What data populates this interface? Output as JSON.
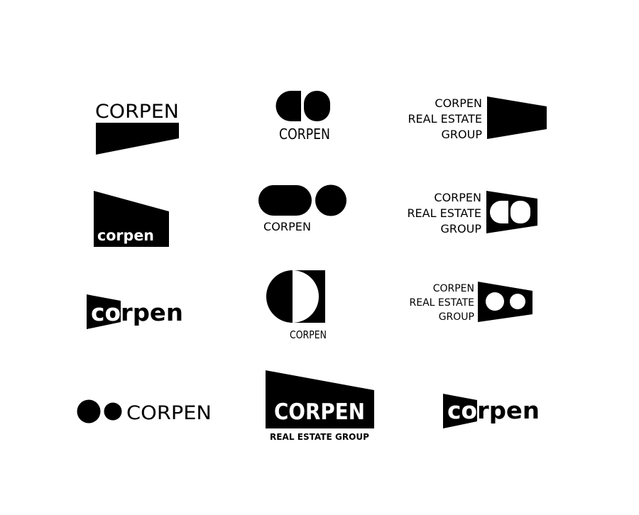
{
  "colors": {
    "ink": "#000000",
    "paper": "#ffffff"
  },
  "logos": {
    "l1": {
      "text": "CORPEN"
    },
    "l2": {
      "text": "CORPEN"
    },
    "l3": {
      "line1": "CORPEN",
      "line2": "REAL ESTATE",
      "line3": "GROUP"
    },
    "l4": {
      "text": "corpen"
    },
    "l5": {
      "text": "CORPEN"
    },
    "l6": {
      "line1": "CORPEN",
      "line2": "REAL ESTATE",
      "line3": "GROUP"
    },
    "l7": {
      "text": "corpen"
    },
    "l8": {
      "text": "CORPEN"
    },
    "l9": {
      "line1": "CORPEN",
      "line2": "REAL ESTATE",
      "line3": "GROUP"
    },
    "l10": {
      "text": "CORPEN"
    },
    "l11": {
      "text": "CORPEN",
      "tagline": "REAL  ESTATE  GROUP"
    },
    "l12": {
      "text": "corpen"
    }
  }
}
